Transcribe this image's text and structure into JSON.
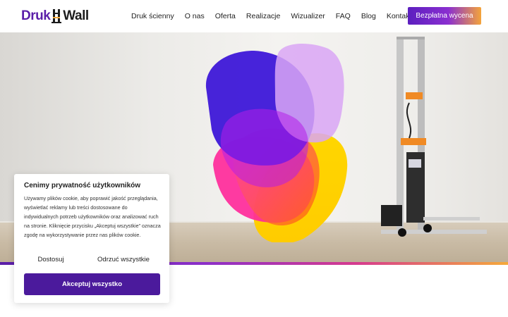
{
  "brand": {
    "part1": "Druk",
    "part2": "Wall",
    "mark_icon": "printer-tower-icon",
    "accent": "#5a1ea8"
  },
  "nav": {
    "items": [
      {
        "label": "Druk ścienny"
      },
      {
        "label": "O nas"
      },
      {
        "label": "Oferta"
      },
      {
        "label": "Realizacje"
      },
      {
        "label": "Wizualizer"
      },
      {
        "label": "FAQ"
      },
      {
        "label": "Blog"
      },
      {
        "label": "Kontakt"
      }
    ],
    "cta": "Bezpłatna wycena"
  },
  "hero": {
    "art_colors": [
      "#3d17d8",
      "#b51ee8",
      "#ff2a9a",
      "#ffd400",
      "#ff8c00",
      "#d9a6f5"
    ],
    "bar_colors": [
      "#5a1ea8",
      "#d63b8f",
      "#f5a93a"
    ]
  },
  "cookie": {
    "title": "Cenimy prywatność użytkowników",
    "text": "Używamy plików cookie, aby poprawić jakość przeglądania, wyświetlać reklamy lub treści dostosowane do indywidualnych potrzeb użytkowników oraz analizować ruch na stronie. Kliknięcie przycisku „Akceptuj wszystkie” oznacza zgodę na wykorzystywanie przez nas plików cookie.",
    "customize": "Dostosuj",
    "reject": "Odrzuć wszystkie",
    "accept": "Akceptuj wszystko"
  }
}
